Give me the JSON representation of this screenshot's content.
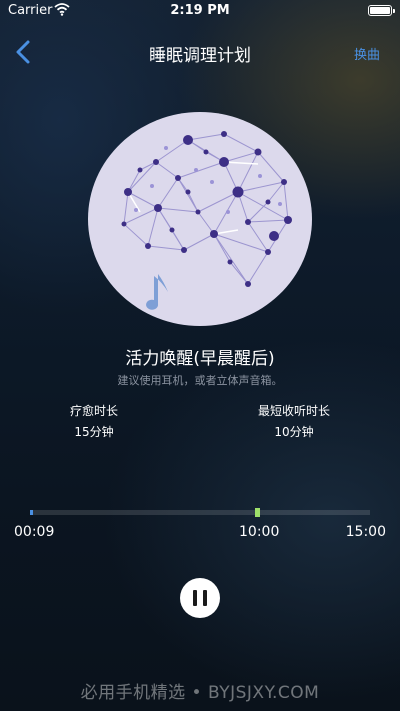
{
  "status_bar": {
    "carrier": "Carrier",
    "time": "2:19 PM",
    "battery_level": 1.0
  },
  "nav": {
    "title": "睡眠调理计划",
    "switch_label": "换曲",
    "back_icon": "chevron-left-icon"
  },
  "artwork": {
    "icon": "brain-network-icon",
    "note_icon": "music-note-icon"
  },
  "track": {
    "title": "活力唤醒(早晨醒后)",
    "hint": "建议使用耳机，或者立体声音箱。"
  },
  "stats": {
    "healing_label": "疗愈时长",
    "healing_value": "15分钟",
    "listen_label": "最短收听时长",
    "listen_value": "10分钟"
  },
  "player": {
    "elapsed": "00:09",
    "marker_time": "10:00",
    "total": "15:00",
    "progress_fraction": 0.01,
    "marker_fraction": 0.6667,
    "state_icon": "pause-icon",
    "colors": {
      "progress": "#4a90e2",
      "marker": "#9ee06a"
    }
  },
  "watermark": "必用手机精选 • BYJSJXY.COM"
}
